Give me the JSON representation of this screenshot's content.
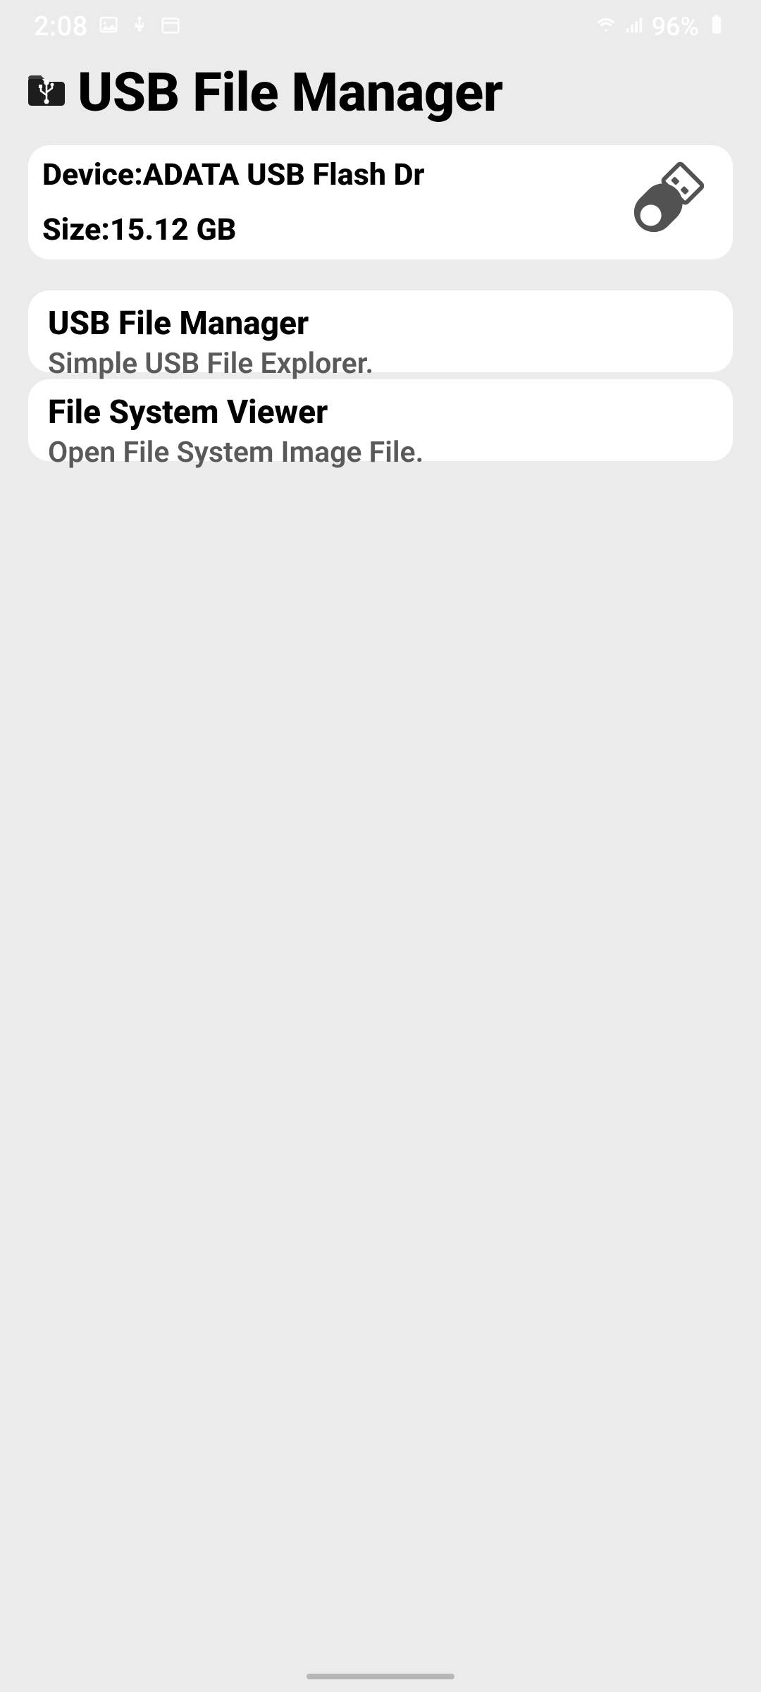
{
  "status_bar": {
    "time": "2:08",
    "battery": "96%"
  },
  "header": {
    "title": "USB File Manager"
  },
  "device": {
    "device_label": "Device:",
    "device_name": "ADATA USB Flash Dr",
    "size_label": "Size:",
    "size_value": "15.12 GB"
  },
  "options": [
    {
      "title": "USB File Manager",
      "subtitle": "Simple USB File Explorer."
    },
    {
      "title": "File System Viewer",
      "subtitle": "Open File System Image File."
    }
  ]
}
